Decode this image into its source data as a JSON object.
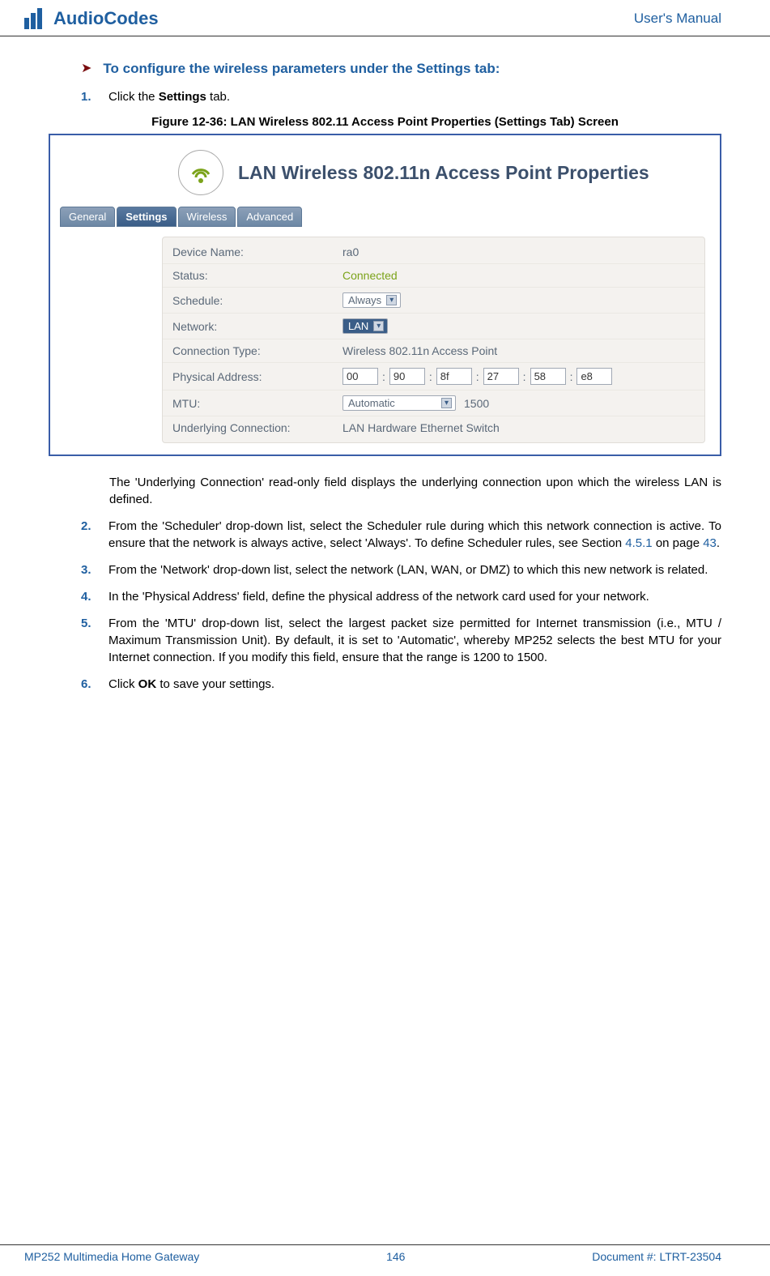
{
  "header": {
    "logo_text": "AudioCodes",
    "right_text": "User's Manual"
  },
  "section": {
    "heading": "To configure the wireless parameters under the Settings tab:",
    "step1_num": "1.",
    "step1_prefix": "Click the ",
    "step1_bold": "Settings",
    "step1_suffix": " tab."
  },
  "figure": {
    "caption": "Figure 12-36: LAN Wireless 802.11 Access Point Properties (Settings Tab) Screen"
  },
  "panel": {
    "title": "LAN Wireless 802.11n Access Point Properties",
    "tabs": {
      "general": "General",
      "settings": "Settings",
      "wireless": "Wireless",
      "advanced": "Advanced"
    },
    "rows": {
      "device_name_label": "Device Name:",
      "device_name_value": "ra0",
      "status_label": "Status:",
      "status_value": "Connected",
      "schedule_label": "Schedule:",
      "schedule_value": "Always",
      "network_label": "Network:",
      "network_value": "LAN",
      "conn_type_label": "Connection Type:",
      "conn_type_value": "Wireless 802.11n Access Point",
      "phy_label": "Physical Address:",
      "phy": [
        "00",
        "90",
        "8f",
        "27",
        "58",
        "e8"
      ],
      "mtu_label": "MTU:",
      "mtu_mode": "Automatic",
      "mtu_value": "1500",
      "underlying_label": "Underlying Connection:",
      "underlying_value": "LAN Hardware Ethernet Switch"
    }
  },
  "body": {
    "para1": "The 'Underlying Connection' read-only field displays the underlying connection upon which the wireless LAN is defined.",
    "step2_num": "2.",
    "step2_text_a": "From the 'Scheduler' drop-down list, select the Scheduler rule during which this network connection is active. To ensure that the network is always active, select 'Always'. To define Scheduler rules, see Section ",
    "step2_link1": "4.5.1",
    "step2_text_b": " on page ",
    "step2_link2": "43",
    "step2_text_c": ".",
    "step3_num": "3.",
    "step3_text": "From the 'Network' drop-down list, select the network (LAN, WAN, or DMZ) to which this new network is related.",
    "step4_num": "4.",
    "step4_text": "In the 'Physical Address' field, define the physical address of the network card used for your network.",
    "step5_num": "5.",
    "step5_text": "From the 'MTU' drop-down list, select the largest packet size permitted for Internet transmission (i.e., MTU / Maximum Transmission Unit). By default, it is set to 'Automatic', whereby MP252 selects the best MTU for your Internet connection. If you modify this field, ensure that the range is 1200 to 1500.",
    "step6_num": "6.",
    "step6_prefix": "Click ",
    "step6_bold": "OK",
    "step6_suffix": " to save your settings."
  },
  "footer": {
    "left": "MP252 Multimedia Home Gateway",
    "center": "146",
    "right": "Document #: LTRT-23504"
  }
}
